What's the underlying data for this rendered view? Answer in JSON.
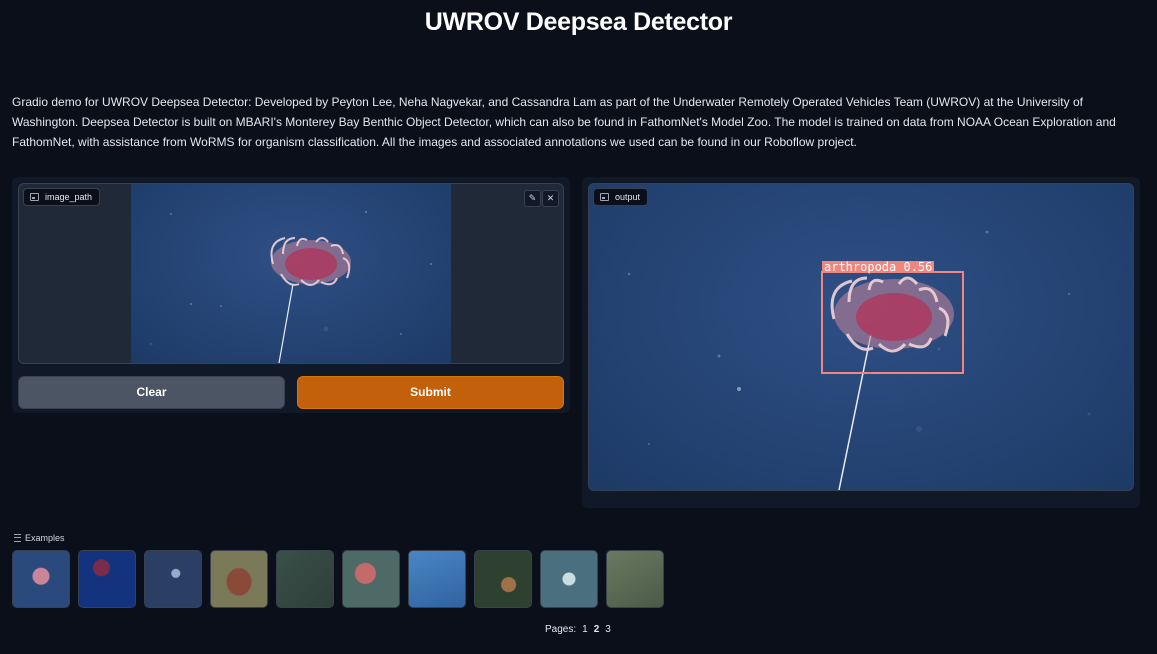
{
  "header": {
    "title": "UWROV Deepsea Detector",
    "description": "Gradio demo for UWROV Deepsea Detector: Developed by Peyton Lee, Neha Nagvekar, and Cassandra Lam as part of the Underwater Remotely Operated Vehicles Team (UWROV) at the University of Washington. Deepsea Detector is built on MBARI's Monterey Bay Benthic Object Detector, which can also be found in FathomNet's Model Zoo. The model is trained on data from NOAA Ocean Exploration and FathomNet, with assistance from WoRMS for organism classification. All the images and associated annotations we used can be found in our Roboflow project."
  },
  "input": {
    "label": "image_path",
    "icon": "image-icon",
    "edit_icon": "pencil-icon",
    "close_icon": "close-icon"
  },
  "buttons": {
    "clear": "Clear",
    "submit": "Submit"
  },
  "output": {
    "label": "output",
    "icon": "image-icon",
    "detection_label": "arthropoda 0.56",
    "detection_color": "#f0877e"
  },
  "examples": {
    "label": "Examples",
    "count": 10
  },
  "pagination": {
    "label": "Pages:",
    "pages": [
      "1",
      "2",
      "3"
    ],
    "current": "2"
  },
  "colors": {
    "background": "#0b0f19",
    "panel": "#111827",
    "accent": "#c2600c",
    "secondary_button": "#4b5563"
  }
}
